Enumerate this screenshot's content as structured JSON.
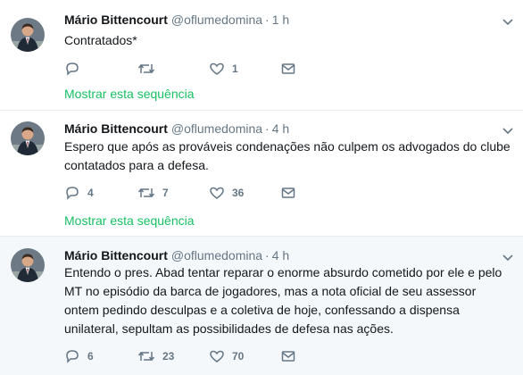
{
  "colors": {
    "accent_green": "#17bf63",
    "meta_gray": "#657786",
    "highlight_bg": "#f5f8fa"
  },
  "tweets": [
    {
      "name": "Mário Bittencourt",
      "handle": "@oflumedomina",
      "dot": "·",
      "time": "1 h",
      "text": "Contratados*",
      "replies": "",
      "retweets": "",
      "likes": "1",
      "thread_link": "Mostrar esta sequência"
    },
    {
      "name": "Mário Bittencourt",
      "handle": "@oflumedomina",
      "dot": "·",
      "time": "4 h",
      "text": "Espero que após as prováveis condenações não culpem os advogados do clube contatados para a defesa.",
      "replies": "4",
      "retweets": "7",
      "likes": "36",
      "thread_link": "Mostrar esta sequência"
    },
    {
      "name": "Mário Bittencourt",
      "handle": "@oflumedomina",
      "dot": "·",
      "time": "4 h",
      "text": "Entendo o pres. Abad tentar reparar o enorme absurdo cometido por ele e pelo MT no episódio da barca de jogadores, mas a nota oficial de seu assessor ontem pedindo desculpas e a coletiva de hoje, confessando a dispensa unilateral, sepultam as possibilidades de defesa nas ações.",
      "replies": "6",
      "retweets": "23",
      "likes": "70",
      "thread_link": ""
    }
  ],
  "icons": {
    "reply": "reply-icon",
    "retweet": "retweet-icon",
    "like": "heart-icon",
    "dm": "envelope-icon",
    "caret": "chevron-down-icon"
  }
}
